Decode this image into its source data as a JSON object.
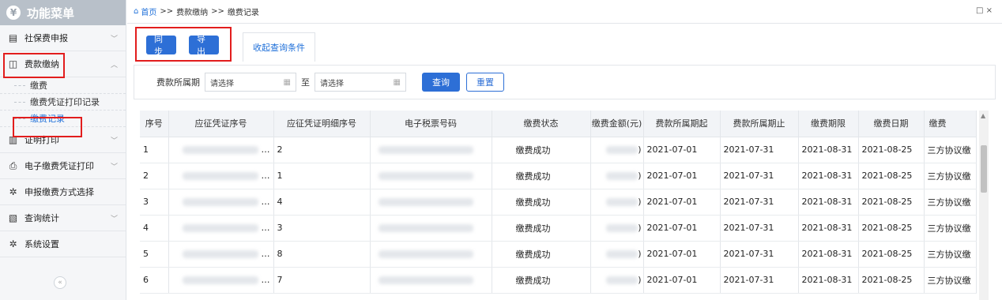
{
  "sidebar": {
    "title": "功能菜单",
    "items": [
      {
        "label": "社保费申报",
        "icon": "document-icon",
        "chevron": "﹀"
      },
      {
        "label": "费款缴纳",
        "icon": "bookmark-icon",
        "chevron": "︿"
      },
      {
        "label": "证明打印",
        "icon": "certificate-icon",
        "chevron": "﹀"
      },
      {
        "label": "电子缴费凭证打印",
        "icon": "printer-icon",
        "chevron": "﹀"
      },
      {
        "label": "申报缴费方式选择",
        "icon": "gear-icon",
        "chevron": ""
      },
      {
        "label": "查询统计",
        "icon": "chart-icon",
        "chevron": "﹀"
      },
      {
        "label": "系统设置",
        "icon": "gear-icon",
        "chevron": ""
      }
    ],
    "subitems": [
      {
        "label": "缴费"
      },
      {
        "label": "缴费凭证打印记录"
      },
      {
        "label": "缴费记录"
      }
    ],
    "collapse": "«"
  },
  "breadcrumb": {
    "home": "首页",
    "sep": ">>",
    "level2": "费款缴纳",
    "level3": "缴费记录"
  },
  "window_controls": "□ ×",
  "toolbar": {
    "sync_label": "同步",
    "export_label": "导出",
    "collapse_tab_label": "收起查询条件"
  },
  "filter": {
    "period_label": "费款所属期",
    "from_placeholder": "请选择",
    "to_label": "至",
    "to_placeholder": "请选择",
    "query_label": "查询",
    "reset_label": "重置"
  },
  "table": {
    "headers": [
      "序号",
      "应征凭证序号",
      "应征凭证明细序号",
      "电子税票号码",
      "缴费状态",
      "缴费金额(元)",
      "费款所属期起",
      "费款所属期止",
      "缴费期限",
      "缴费日期",
      "缴费"
    ],
    "rows": [
      {
        "no": "1",
        "voucher_suffix": "…",
        "detail_no": "2",
        "status": "缴费成功",
        "amount_suffix": ")",
        "start": "2021-07-01",
        "end": "2021-07-31",
        "deadline": "2021-08-31",
        "date": "2021-08-25",
        "method": "三方协议缴"
      },
      {
        "no": "2",
        "voucher_suffix": "…",
        "detail_no": "1",
        "status": "缴费成功",
        "amount_suffix": ")",
        "start": "2021-07-01",
        "end": "2021-07-31",
        "deadline": "2021-08-31",
        "date": "2021-08-25",
        "method": "三方协议缴"
      },
      {
        "no": "3",
        "voucher_suffix": "…",
        "detail_no": "4",
        "status": "缴费成功",
        "amount_suffix": ")",
        "start": "2021-07-01",
        "end": "2021-07-31",
        "deadline": "2021-08-31",
        "date": "2021-08-25",
        "method": "三方协议缴"
      },
      {
        "no": "4",
        "voucher_suffix": "…",
        "detail_no": "3",
        "status": "缴费成功",
        "amount_suffix": ")",
        "start": "2021-07-01",
        "end": "2021-07-31",
        "deadline": "2021-08-31",
        "date": "2021-08-25",
        "method": "三方协议缴"
      },
      {
        "no": "5",
        "voucher_suffix": "…",
        "detail_no": "8",
        "status": "缴费成功",
        "amount_suffix": ")",
        "start": "2021-07-01",
        "end": "2021-07-31",
        "deadline": "2021-08-31",
        "date": "2021-08-25",
        "method": "三方协议缴"
      },
      {
        "no": "6",
        "voucher_suffix": "…",
        "detail_no": "7",
        "status": "缴费成功",
        "amount_suffix": ")",
        "start": "2021-07-01",
        "end": "2021-07-31",
        "deadline": "2021-08-31",
        "date": "2021-08-25",
        "method": "三方协议缴"
      }
    ]
  },
  "colors": {
    "accent": "#2d6fd6",
    "highlight_box": "#e21d1d",
    "sidebar_header": "#b8c0c9"
  }
}
